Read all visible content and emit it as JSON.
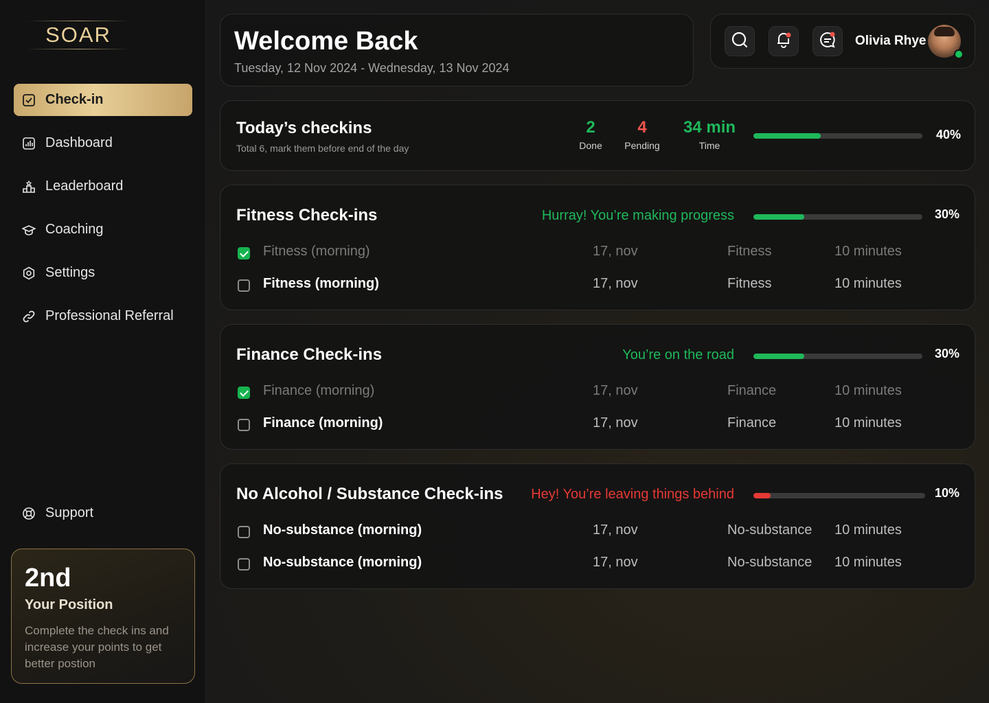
{
  "brand": {
    "logo_text": "SOAR",
    "gold": "#e7cf97"
  },
  "nav": {
    "items": [
      {
        "label": "Check-in",
        "icon": "checkbox-icon",
        "active": true
      },
      {
        "label": "Dashboard",
        "icon": "bar-chart-icon"
      },
      {
        "label": "Leaderboard",
        "icon": "podium-icon"
      },
      {
        "label": "Coaching",
        "icon": "graduation-cap-icon"
      },
      {
        "label": "Settings",
        "icon": "gear-icon"
      },
      {
        "label": "Professional Referral",
        "icon": "link-icon"
      }
    ],
    "support_label": "Support"
  },
  "position": {
    "rank": "2nd",
    "label": "Your Position",
    "description": "Complete the check ins and increase your points to get better postion"
  },
  "header": {
    "title": "Welcome Back",
    "date_range": "Tuesday, 12 Nov 2024 - Wednesday, 13 Nov 2024"
  },
  "user": {
    "name": "Olivia Rhye",
    "icons": [
      "search-icon",
      "notification-bell-icon",
      "chat-icon"
    ],
    "online": true
  },
  "today": {
    "title": "Today’s checkins",
    "subtitle": "Total 6, mark them before end of the day",
    "done_value": "2",
    "done_label": "Done",
    "pending_value": "4",
    "pending_label": "Pending",
    "time_value": "34 min",
    "time_label": "Time",
    "progress": 40,
    "progress_label": "40%"
  },
  "sections": [
    {
      "title": "Fitness Check-ins",
      "message": "Hurray! You’re making progress",
      "tone": "good",
      "progress": 30,
      "progress_label": "30%",
      "rows": [
        {
          "name": "Fitness (morning)",
          "date": "17, nov",
          "category": "Fitness",
          "duration": "10 minutes",
          "done": true
        },
        {
          "name": "Fitness (morning)",
          "date": "17, nov",
          "category": "Fitness",
          "duration": "10 minutes",
          "done": false
        }
      ]
    },
    {
      "title": "Finance Check-ins",
      "message": "You’re on the road",
      "tone": "good",
      "progress": 30,
      "progress_label": "30%",
      "rows": [
        {
          "name": "Finance (morning)",
          "date": "17, nov",
          "category": "Finance",
          "duration": "10 minutes",
          "done": true
        },
        {
          "name": "Finance (morning)",
          "date": "17, nov",
          "category": "Finance",
          "duration": "10 minutes",
          "done": false
        }
      ]
    },
    {
      "title": "No Alcohol / Substance Check-ins",
      "message": "Hey! You’re leaving things behind",
      "tone": "bad",
      "progress": 10,
      "progress_label": "10%",
      "rows": [
        {
          "name": "No-substance (morning)",
          "date": "17, nov",
          "category": "No-substance",
          "duration": "10 minutes",
          "done": false
        },
        {
          "name": "No-substance (morning)",
          "date": "17, nov",
          "category": "No-substance",
          "duration": "10 minutes",
          "done": false
        }
      ]
    }
  ],
  "colors": {
    "good": "#1fb85a",
    "bad": "#e53935",
    "pending": "#f0554c"
  }
}
